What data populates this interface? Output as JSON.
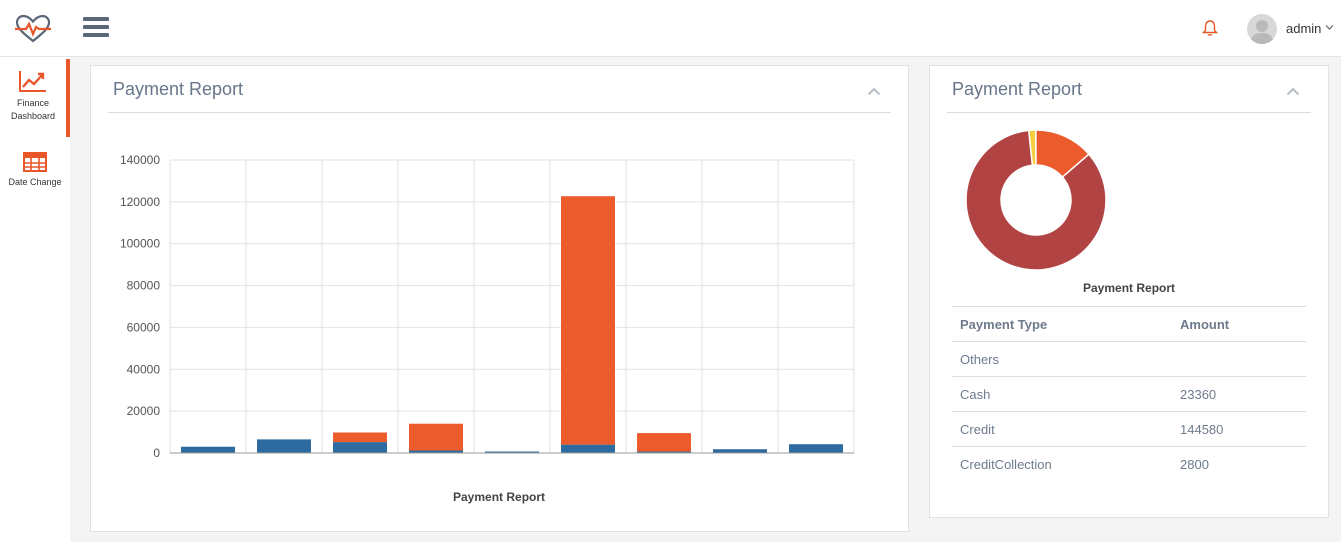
{
  "header": {
    "user": "admin"
  },
  "sidebar": {
    "items": [
      {
        "label_line1": "Finance",
        "label_line2": "Dashboard",
        "icon": "trending-up-icon",
        "active": true
      },
      {
        "label": "Date Change",
        "icon": "table-grid-icon",
        "active": false
      }
    ]
  },
  "colors": {
    "accent": "#e8562a",
    "blue": "#2d6a9f",
    "donut_main": "#b24343",
    "donut_orange": "#ec5b2c",
    "donut_yellow": "#f4d03f"
  },
  "bar_card": {
    "title": "Payment Report",
    "caption": "Payment Report"
  },
  "donut_card": {
    "title": "Payment Report",
    "caption": "Payment Report",
    "table": {
      "headers": [
        "Payment Type",
        "Amount"
      ],
      "rows": [
        [
          "Others",
          ""
        ],
        [
          "Cash",
          "23360"
        ],
        [
          "Credit",
          "144580"
        ],
        [
          "CreditCollection",
          "2800"
        ]
      ]
    }
  },
  "chart_data": [
    {
      "type": "bar",
      "stacked": true,
      "title": "Payment Report",
      "categories": [
        "",
        "",
        "",
        "",
        "",
        "",
        "",
        "",
        ""
      ],
      "ylim": [
        0,
        140000
      ],
      "yticks": [
        0,
        20000,
        40000,
        60000,
        80000,
        100000,
        120000,
        140000
      ],
      "grid": true,
      "series": [
        {
          "color": "#2d6a9f",
          "values": [
            3000,
            6500,
            5200,
            1200,
            700,
            4000,
            700,
            1800,
            4200
          ]
        },
        {
          "color": "#ec5b2c",
          "values": [
            0,
            0,
            4600,
            12800,
            0,
            118700,
            8800,
            0,
            0
          ]
        }
      ]
    },
    {
      "type": "pie",
      "donut": true,
      "title": "Payment Report",
      "labels": [
        "Others",
        "Cash",
        "Credit",
        "CreditCollection"
      ],
      "values": [
        0,
        23360,
        144580,
        2800
      ],
      "colors": [
        "#b24343",
        "#ec5b2c",
        "#b24343",
        "#f4d03f"
      ]
    }
  ]
}
